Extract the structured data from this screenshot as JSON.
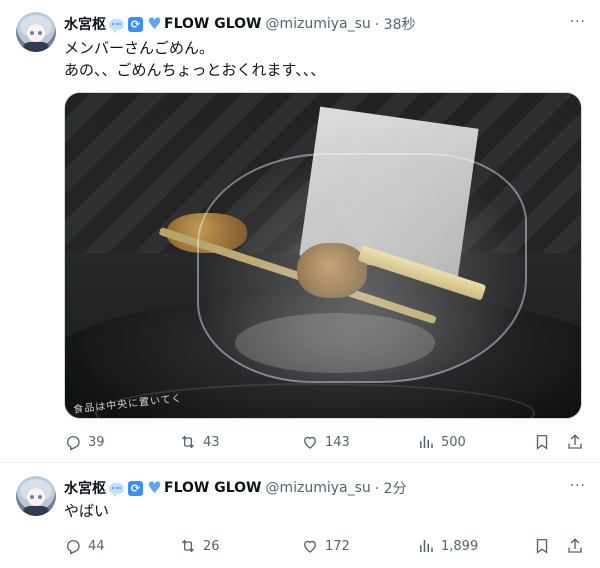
{
  "tweets": [
    {
      "author": {
        "name": "水宮枢",
        "badge_text": "FLOW GLOW",
        "handle": "@mizumiya_su",
        "time": "· 38秒"
      },
      "text_lines": [
        "メンバーさんごめん。",
        "あの、、ごめんちょっとおくれます、、、"
      ],
      "media": {
        "label": "食品は中央に置いてく",
        "icons": [
          "microwave-photo"
        ]
      },
      "actions": {
        "replies": "39",
        "reposts": "43",
        "likes": "143",
        "views": "500"
      }
    },
    {
      "author": {
        "name": "水宮枢",
        "badge_text": "FLOW GLOW",
        "handle": "@mizumiya_su",
        "time": "· 2分"
      },
      "text_lines": [
        "やばい"
      ],
      "actions": {
        "replies": "44",
        "reposts": "26",
        "likes": "172",
        "views": "1,899"
      }
    }
  ],
  "more_glyph": "···",
  "colors": {
    "text": "#0f1419",
    "muted": "#536471",
    "divider": "#eff3f4",
    "accent": "#1d9bf0"
  },
  "icons": [
    "reply-icon",
    "repost-icon",
    "like-icon",
    "views-icon",
    "bookmark-icon",
    "share-icon"
  ]
}
